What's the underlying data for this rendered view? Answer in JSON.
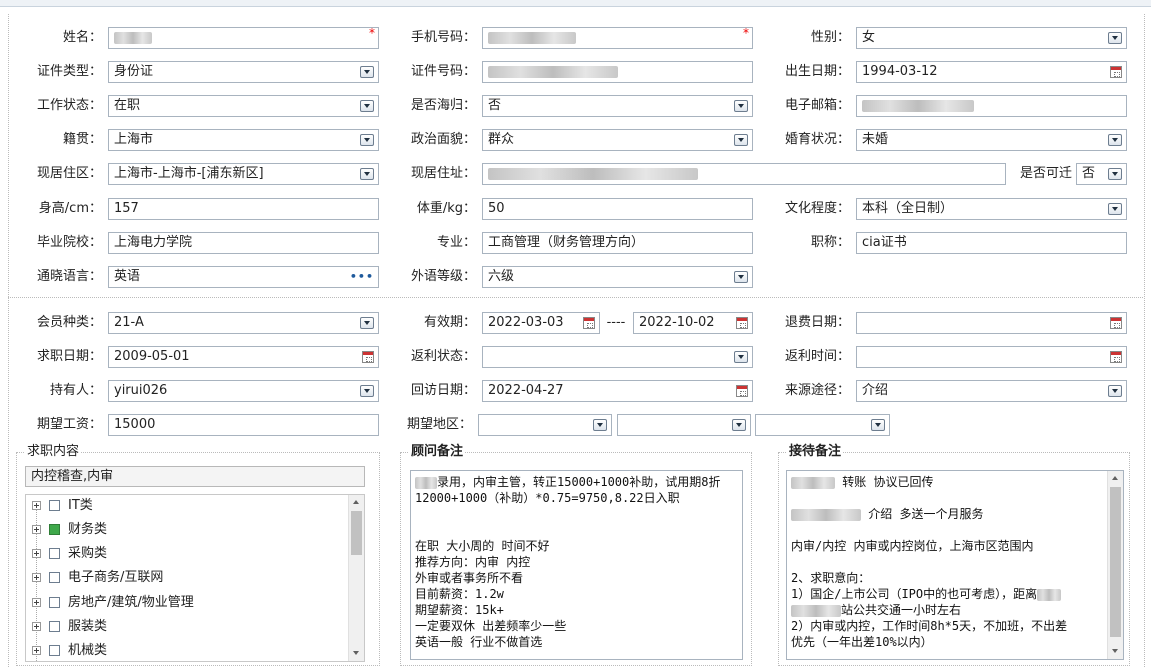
{
  "form": {
    "name": {
      "label": "姓名：",
      "value": "",
      "required": "*"
    },
    "phone": {
      "label": "手机号码：",
      "value": "",
      "required": "*"
    },
    "gender": {
      "label": "性别：",
      "value": "女"
    },
    "id_type": {
      "label": "证件类型：",
      "value": "身份证"
    },
    "id_number": {
      "label": "证件号码：",
      "value": ""
    },
    "birth_date": {
      "label": "出生日期：",
      "value": "1994-03-12"
    },
    "work_status": {
      "label": "工作状态：",
      "value": "在职"
    },
    "returnee": {
      "label": "是否海归：",
      "value": "否"
    },
    "email": {
      "label": "电子邮箱：",
      "value": ""
    },
    "native_place": {
      "label": "籍贯：",
      "value": "上海市"
    },
    "political": {
      "label": "政治面貌：",
      "value": "群众"
    },
    "marital": {
      "label": "婚育状况：",
      "value": "未婚"
    },
    "residence_area": {
      "label": "现居住区：",
      "value": "上海市-上海市-[浦东新区]"
    },
    "residence_address": {
      "label": "现居住址：",
      "value": ""
    },
    "relocatable": {
      "label": "是否可迁",
      "value": "否"
    },
    "height": {
      "label": "身高/cm：",
      "value": "157"
    },
    "weight": {
      "label": "体重/kg：",
      "value": "50"
    },
    "education": {
      "label": "文化程度：",
      "value": "本科（全日制）"
    },
    "school": {
      "label": "毕业院校：",
      "value": "上海电力学院"
    },
    "major": {
      "label": "专业：",
      "value": "工商管理（财务管理方向）"
    },
    "title": {
      "label": "职称：",
      "value": "cia证书"
    },
    "languages": {
      "label": "通晓语言：",
      "value": "英语"
    },
    "foreign_level": {
      "label": "外语等级：",
      "value": "六级"
    }
  },
  "member": {
    "member_type": {
      "label": "会员种类：",
      "value": "21-A"
    },
    "valid_period": {
      "label": "有效期：",
      "from": "2022-03-03",
      "separator": "----",
      "to": "2022-10-02"
    },
    "refund_date": {
      "label": "退费日期：",
      "value": ""
    },
    "job_date": {
      "label": "求职日期：",
      "value": "2009-05-01"
    },
    "rebate_status": {
      "label": "返利状态：",
      "value": ""
    },
    "rebate_time": {
      "label": "返利时间：",
      "value": ""
    },
    "holder": {
      "label": "持有人：",
      "value": "yirui026"
    },
    "visit_date": {
      "label": "回访日期：",
      "value": "2022-04-27"
    },
    "source": {
      "label": "来源途径：",
      "value": "介绍"
    },
    "expected_salary": {
      "label": "期望工资：",
      "value": "15000"
    },
    "expected_area": {
      "label": "期望地区：",
      "value1": "",
      "value2": "",
      "value3": ""
    }
  },
  "job_content": {
    "title": "求职内容",
    "summary": "内控稽查,内审",
    "items": [
      {
        "label": "IT类",
        "checked": false
      },
      {
        "label": "财务类",
        "checked": true
      },
      {
        "label": "采购类",
        "checked": false
      },
      {
        "label": "电子商务/互联网",
        "checked": false
      },
      {
        "label": "房地产/建筑/物业管理",
        "checked": false
      },
      {
        "label": "服装类",
        "checked": false
      },
      {
        "label": "机械类",
        "checked": false
      }
    ]
  },
  "advisor_notes": {
    "title": "顾问备注",
    "lines": [
      "录用，内审主管，转正15000+1000补助，试用期8折",
      "12000+1000（补助）*0.75=9750,8.22日入职",
      "",
      "",
      "在职 大小周的 时间不好",
      "推荐方向：内审 内控",
      "外审或者事务所不看",
      "目前薪资：1.2w",
      "期望薪资：15k+",
      "一定要双休  出差频率少一些",
      "英语一般  行业不做首选"
    ]
  },
  "reception_notes": {
    "title": "接待备注",
    "lines": [
      " 转账 协议已回传",
      "",
      " 介绍  多送一个月服务",
      "",
      "内审/内控   内审或内控岗位，上海市区范围内",
      "",
      "2、求职意向：",
      "1）国企/上市公司（IPO中的也可考虑），距离",
      "站公共交通一小时左右",
      "2）内审或内控，工作时间8h*5天，不加班，不出差",
      "优先（一年出差10%以内）"
    ]
  },
  "colors": {
    "required": "#e00000",
    "checked": "#3ea84a",
    "border": "#a8b3bf"
  }
}
